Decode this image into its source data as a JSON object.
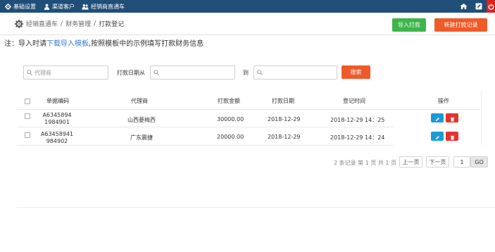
{
  "topnav": {
    "items": [
      {
        "label": "基础设置",
        "icon": "gear-icon"
      },
      {
        "label": "渠道客户",
        "icon": "user-icon"
      },
      {
        "label": "经销商直通车",
        "icon": "users-icon"
      }
    ],
    "right_icons": [
      "home-icon",
      "edit-icon",
      "power-icon"
    ]
  },
  "breadcrumb": {
    "items": [
      "经销直通车",
      "财务管理",
      "打款登记"
    ],
    "separator": "/"
  },
  "header_buttons": {
    "import_label": "导入打款",
    "new_label": "新建打款记录"
  },
  "note": {
    "prefix": "注：导入时请",
    "link": "下载导入模板",
    "suffix": ",按照模板中的示例填写打款财务信息"
  },
  "search": {
    "agent_placeholder": "代理商",
    "date_from_label": "打款日期从",
    "date_to_label": "到",
    "start_value": "",
    "end_value": "",
    "button_label": "搜索"
  },
  "table": {
    "headers": [
      "单据编码",
      "代理商",
      "打款金额",
      "打款日期",
      "登记时间",
      "操作"
    ],
    "rows": [
      {
        "code_line1": "A6345894",
        "code_line2": "1984901",
        "agent": "山西菱梅西",
        "amount": "30000.00",
        "date": "2018-12-29",
        "time": "2018-12-29 14：25"
      },
      {
        "code_line1": "A63458941",
        "code_line2": "984902",
        "agent": "广东震捷",
        "amount": "20000.00",
        "date": "2018-12-29",
        "time": "2018-12-29 14：24"
      }
    ]
  },
  "pagination": {
    "info": "2 条记录 第 1 页 共 1 页",
    "prev_label": "上一页",
    "next_label": "下一页",
    "page_value": "1",
    "go_label": "GO"
  },
  "colors": {
    "topbar": "#1f4e79",
    "import_button": "#3cb54a",
    "primary_orange": "#f05a28",
    "edit_button": "#1a9bd7",
    "delete_button": "#e3342f",
    "link": "#3a7bd5"
  }
}
